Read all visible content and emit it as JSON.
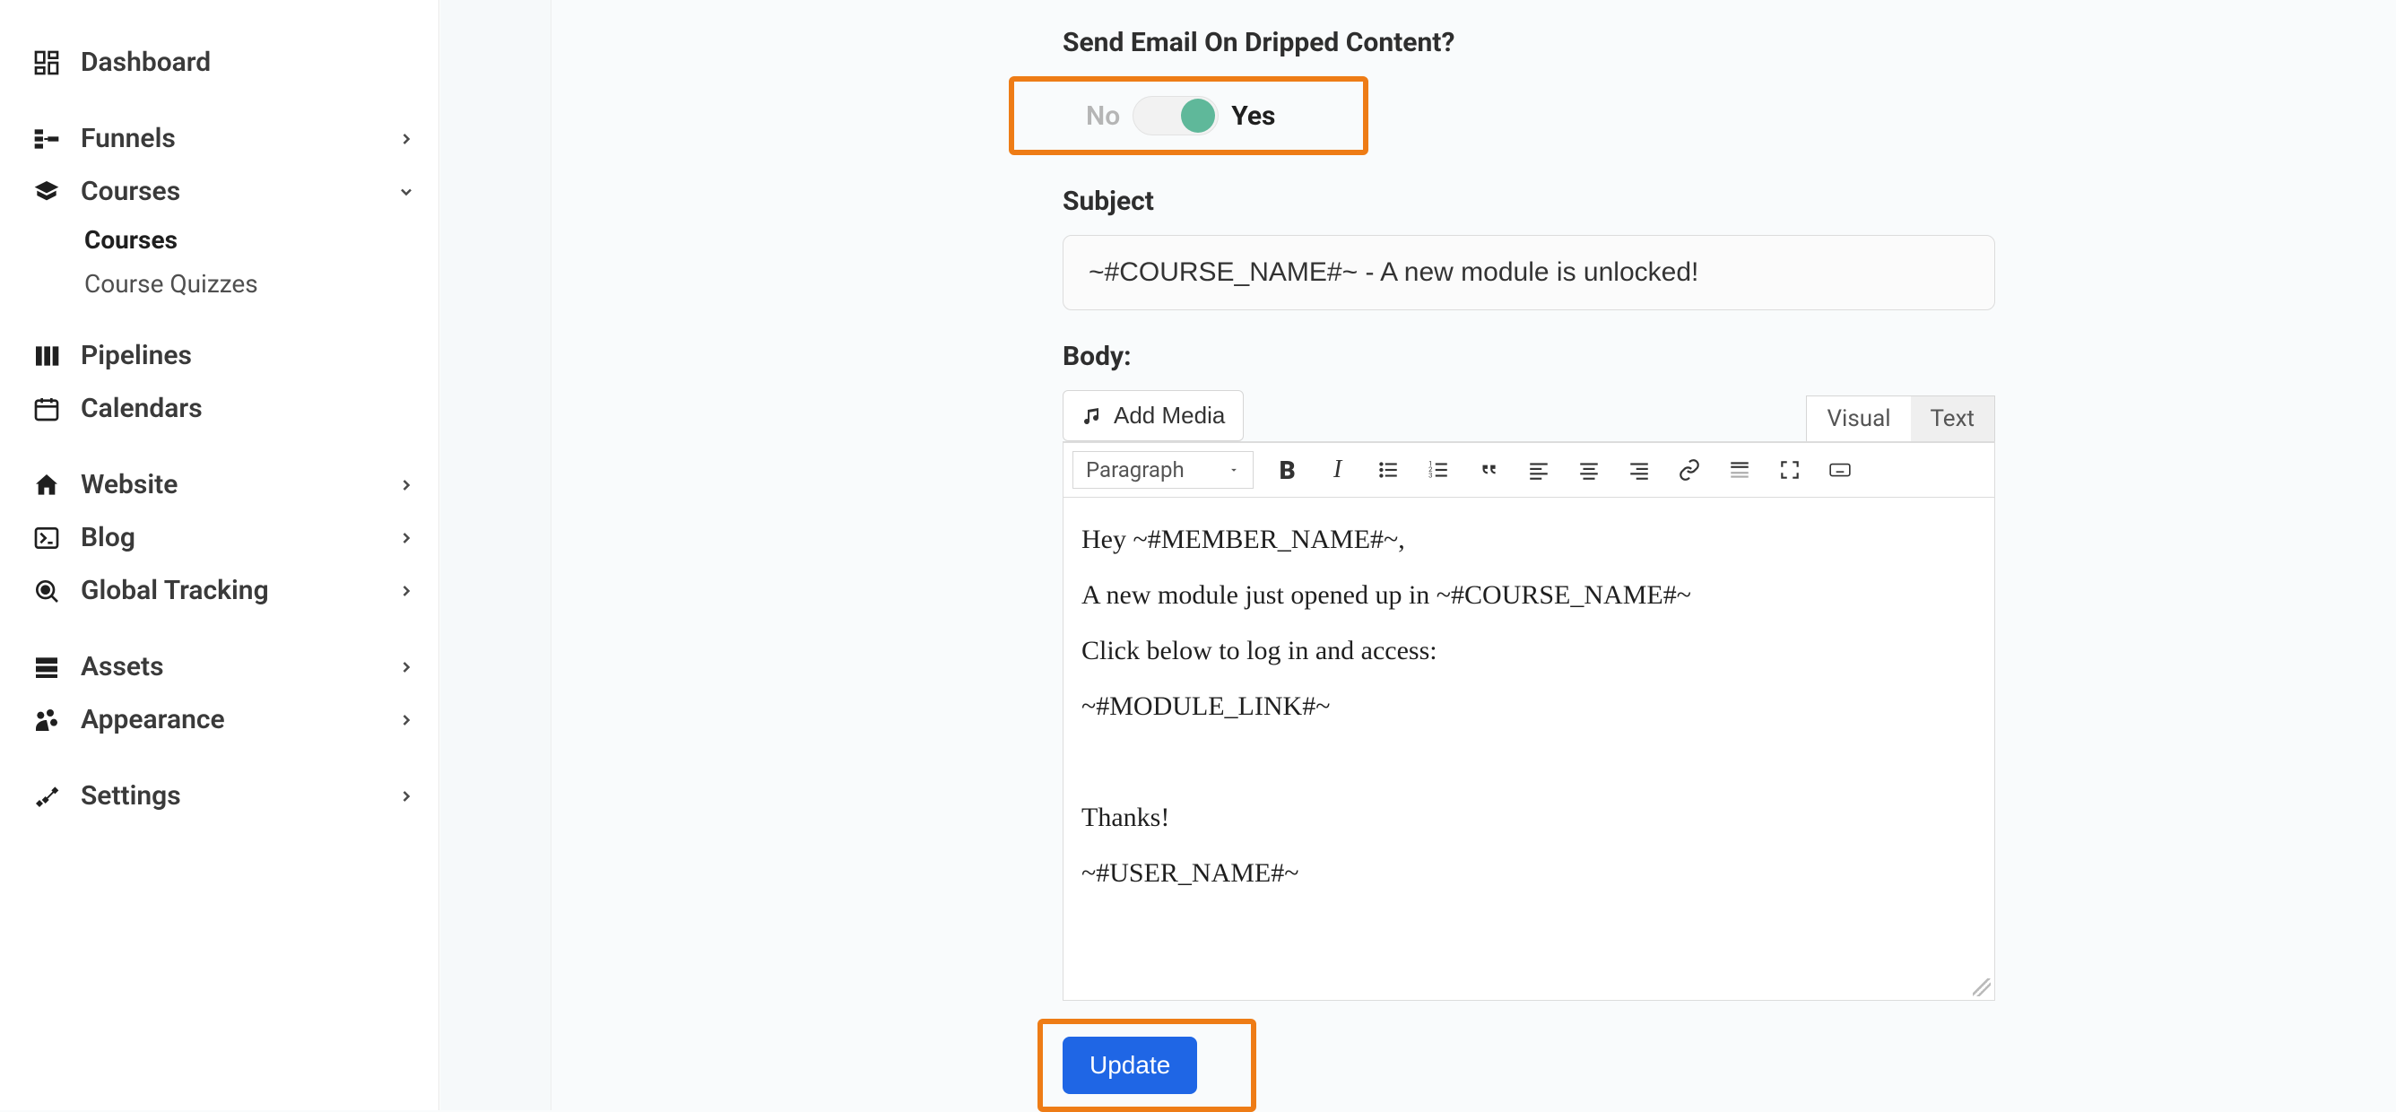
{
  "sidebar": {
    "dashboard": "Dashboard",
    "funnels": "Funnels",
    "courses": "Courses",
    "courses_sub_courses": "Courses",
    "courses_sub_quizzes": "Course Quizzes",
    "pipelines": "Pipelines",
    "calendars": "Calendars",
    "website": "Website",
    "blog": "Blog",
    "global_tracking": "Global Tracking",
    "assets": "Assets",
    "appearance": "Appearance",
    "settings": "Settings"
  },
  "form": {
    "drip_question": "Send Email On Dripped Content?",
    "toggle_no": "No",
    "toggle_yes": "Yes",
    "subject_label": "Subject",
    "subject_value": "~#COURSE_NAME#~ - A new module is unlocked!",
    "body_label": "Body:",
    "add_media": "Add Media",
    "tab_visual": "Visual",
    "tab_text": "Text",
    "paragraph": "Paragraph",
    "body_p1": "Hey ~#MEMBER_NAME#~,",
    "body_p2": "A new module just opened up in ~#COURSE_NAME#~",
    "body_p3": "Click below to log in and access:",
    "body_p4": "~#MODULE_LINK#~",
    "body_p5": "Thanks!",
    "body_p6": "~#USER_NAME#~",
    "update": "Update"
  }
}
